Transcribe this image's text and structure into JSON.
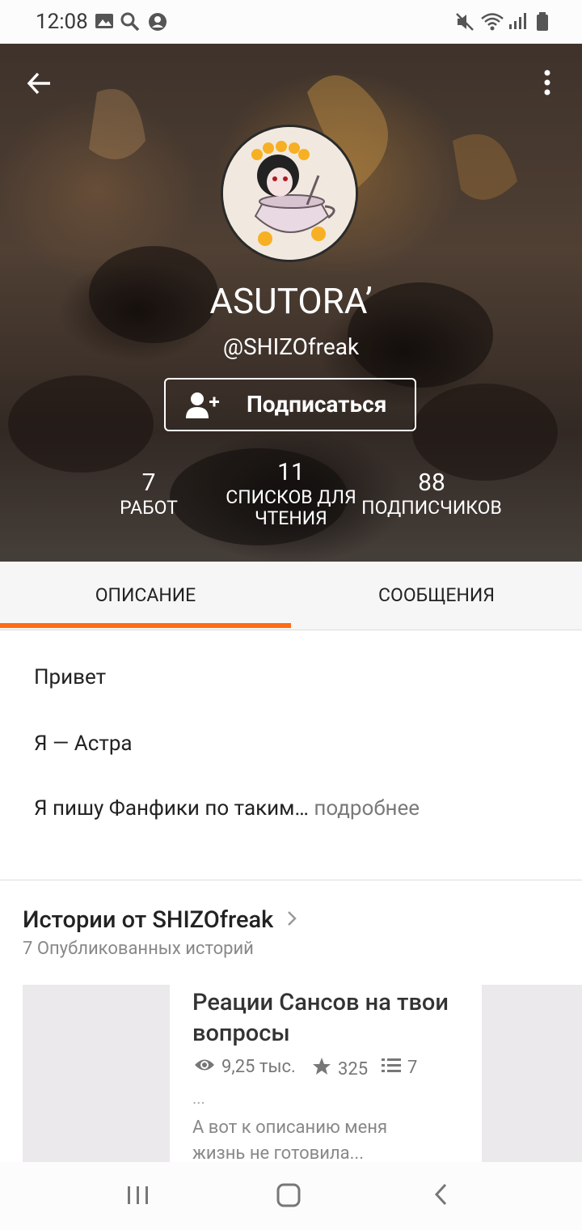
{
  "status": {
    "time": "12:08"
  },
  "profile": {
    "display_name": "ASUTORA’",
    "handle": "@SHIZOfreak",
    "follow_label": "Подписаться",
    "stats": [
      {
        "value": "7",
        "label": "РАБОТ"
      },
      {
        "value": "11",
        "label": "СПИСКОВ ДЛЯ ЧТЕНИЯ"
      },
      {
        "value": "88",
        "label": "ПОДПИСЧИКОВ"
      }
    ]
  },
  "tabs": {
    "about": "ОПИСАНИЕ",
    "messages": "СООБЩЕНИЯ",
    "active": "about"
  },
  "description": {
    "line1": "Привет",
    "line2": "Я — Астра",
    "line3": "Я пишу Фанфики по таким…",
    "more": "подробнее"
  },
  "stories": {
    "title": "Истории от SHIZOfreak",
    "subtitle": "7 Опубликованных историй",
    "items": [
      {
        "title": "Реации Сансов на твои вопросы",
        "reads": "9,25 тыс.",
        "votes": "325",
        "parts": "7",
        "ellipsis": "...",
        "desc": "А вот к описанию меня жизнь не готовила..."
      }
    ]
  },
  "colors": {
    "accent": "#ff6b14",
    "text": "#222222",
    "muted": "#888888"
  }
}
